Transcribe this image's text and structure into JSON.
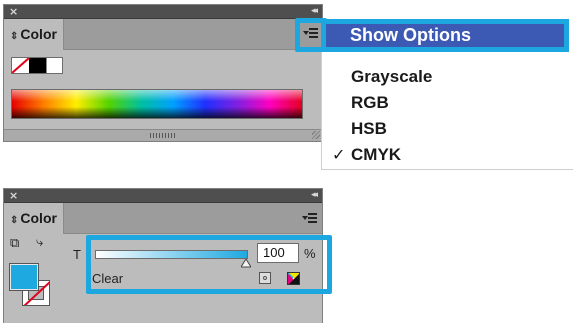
{
  "top_panel": {
    "tab_label": "Color"
  },
  "flyout_menu": {
    "highlighted_item": "Show Options",
    "items": [
      {
        "label": "Grayscale",
        "checked": false
      },
      {
        "label": "RGB",
        "checked": false
      },
      {
        "label": "HSB",
        "checked": false
      },
      {
        "label": "CMYK",
        "checked": true
      }
    ],
    "check_glyph": "✓"
  },
  "bottom_panel": {
    "tab_label": "Color",
    "tint_label": "T",
    "tint_value": "100",
    "tint_unit": "%",
    "tint_level": 1.0,
    "clear_label": "Clear",
    "fill_color": "#1ea9e1"
  },
  "icons": {
    "close": "close-icon",
    "collapse": "double-chevron-left-icon",
    "panel_menu": "panel-menu-icon",
    "fill_stroke_toggle": "swap-fill-stroke-icon",
    "default_colors": "default-fill-stroke-icon"
  },
  "colors": {
    "highlight_border": "#1da7e0",
    "menu_selection": "#3c59b4",
    "panel_bg": "#bcbcbc",
    "titlebar_bg": "#4f4f4f"
  }
}
